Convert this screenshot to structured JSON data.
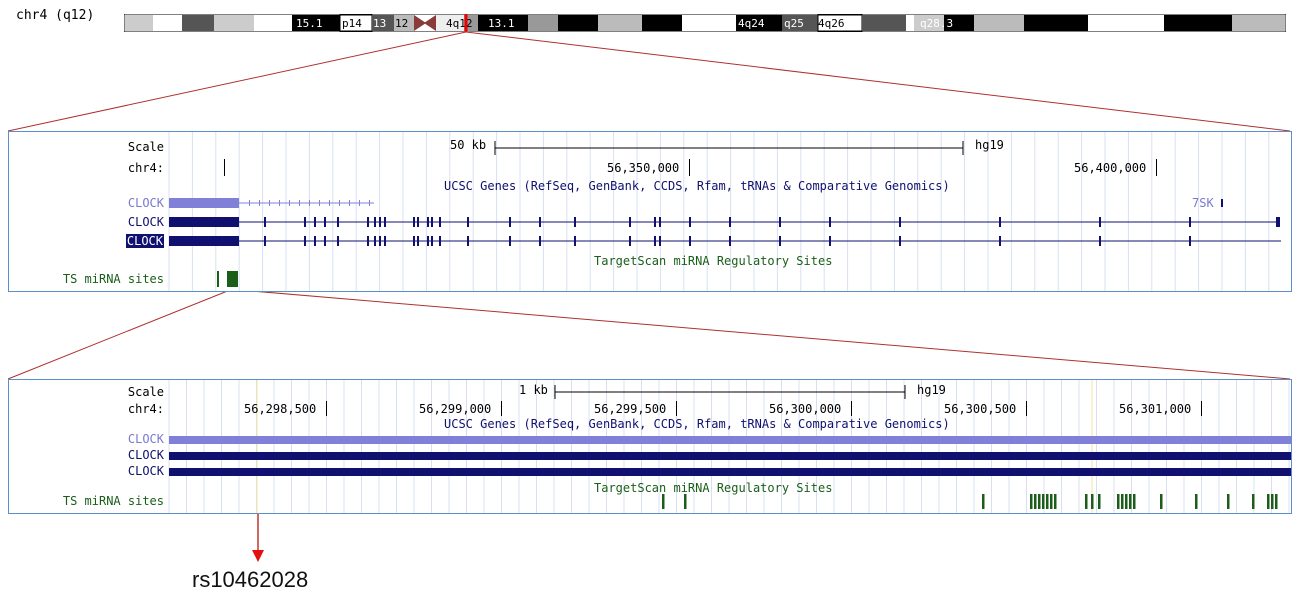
{
  "ideogram": {
    "label": "chr4 (q12)",
    "bands": [
      "15.1",
      "p14",
      "13",
      "12",
      "4q12",
      "13.1",
      "4q24",
      "q25",
      "4q26",
      "q28.3"
    ]
  },
  "panel1": {
    "scale_label": "Scale",
    "scale_text": "50 kb",
    "assembly": "hg19",
    "chrom_label": "chr4:",
    "positions": [
      "56,350,000",
      "56,400,000"
    ],
    "genes_track_title": "UCSC Genes (RefSeq, GenBank, CCDS, Rfam, tRNAs & Comparative Genomics)",
    "gene_labels": [
      "CLOCK",
      "CLOCK",
      "CLOCK"
    ],
    "extra_gene": "7SK",
    "ts_track_title": "TargetScan miRNA Regulatory Sites",
    "ts_label": "TS miRNA sites"
  },
  "panel2": {
    "scale_label": "Scale",
    "scale_text": "1 kb",
    "assembly": "hg19",
    "chrom_label": "chr4:",
    "positions": [
      "56,298,500",
      "56,299,000",
      "56,299,500",
      "56,300,000",
      "56,300,500",
      "56,301,000"
    ],
    "genes_track_title": "UCSC Genes (RefSeq, GenBank, CCDS, Rfam, tRNAs & Comparative Genomics)",
    "gene_labels": [
      "CLOCK",
      "CLOCK",
      "CLOCK"
    ],
    "ts_track_title": "TargetScan miRNA Regulatory Sites",
    "ts_label": "TS miRNA sites"
  },
  "snp_label": "rs10462028",
  "colors": {
    "gene_light": "#8080d8",
    "gene_dark": "#101070",
    "ts_green": "#1a5e1a",
    "connector": "#b03030",
    "panel_border": "#5b8fc9"
  }
}
